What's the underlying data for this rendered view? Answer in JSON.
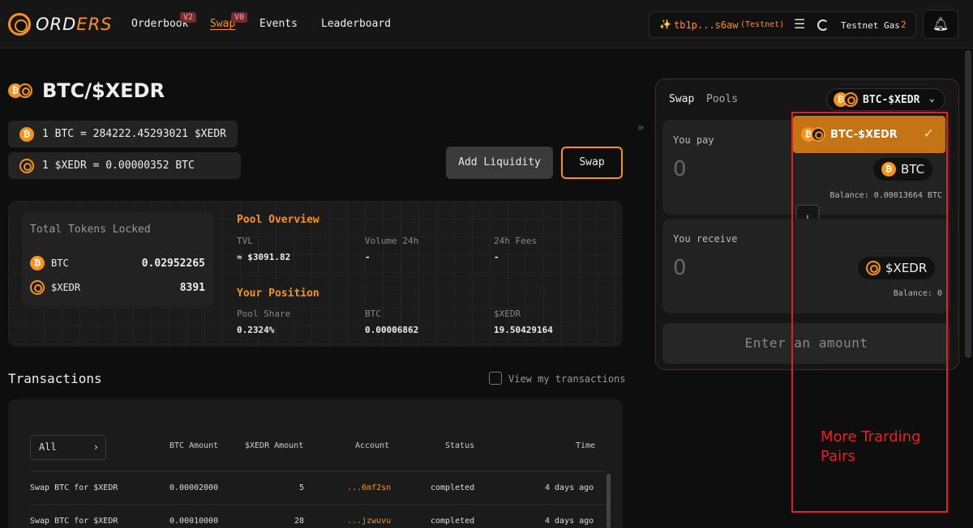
{
  "nav": {
    "logo_prefix": "ORD",
    "logo_suffix": "ERS",
    "items": [
      {
        "label": "Orderbook",
        "badge": "V2"
      },
      {
        "label": "Swap",
        "badge": "V0"
      },
      {
        "label": "Events"
      },
      {
        "label": "Leaderboard"
      }
    ],
    "wallet_address": "tb1p...s6aw",
    "wallet_network": "(Testnet)",
    "gas_label": "Testnet Gas",
    "gas_count": "2",
    "wallet_icon": "✨"
  },
  "pair": {
    "title": "BTC/$XEDR",
    "rate_btc": "1 BTC = 284222.45293021 $XEDR",
    "rate_xedr": "1 $XEDR = 0.00000352 BTC"
  },
  "actions": {
    "add_liquidity": "Add Liquidity",
    "swap": "Swap"
  },
  "pool": {
    "tvl_title": "Total Tokens Locked",
    "tokens": [
      {
        "name": "BTC",
        "value": "0.02952265"
      },
      {
        "name": "$XEDR",
        "value": "8391"
      }
    ],
    "overview_title": "Pool Overview",
    "overview": [
      {
        "label": "TVL",
        "value": "≈ $3091.82"
      },
      {
        "label": "Volume 24h",
        "value": "-"
      },
      {
        "label": "24h Fees",
        "value": "-"
      }
    ],
    "position_title": "Your Position",
    "position": [
      {
        "label": "Pool Share",
        "value": "0.2324%"
      },
      {
        "label": "BTC",
        "value": "0.00006862"
      },
      {
        "label": "$XEDR",
        "value": "19.50429164"
      }
    ]
  },
  "transactions": {
    "title": "Transactions",
    "view_mine": "View my transactions",
    "filter": "All",
    "columns": [
      "BTC Amount",
      "$XEDR Amount",
      "Account",
      "Status",
      "Time"
    ],
    "rows": [
      {
        "type": "Swap BTC for $XEDR",
        "btc": "0.00002000",
        "xedr": "5",
        "account": "...6mf2sn",
        "status": "completed",
        "time": "4 days ago"
      },
      {
        "type": "Swap BTC for $XEDR",
        "btc": "0.00010000",
        "xedr": "28",
        "account": "...jzwuvu",
        "status": "completed",
        "time": "4 days ago"
      }
    ]
  },
  "swap_card": {
    "tabs": [
      "Swap",
      "Pools"
    ],
    "selected_pair": "BTC-$XEDR",
    "you_pay": "You pay",
    "pay_amount": "0",
    "pay_token": "BTC",
    "pay_balance": "Balance: 0.00013664 BTC",
    "you_receive": "You receive",
    "receive_amount": "0",
    "receive_token": "$XEDR",
    "receive_balance": "Balance: 0",
    "cta": "Enter an amount"
  },
  "dropdown": {
    "option": "BTC-$XEDR"
  },
  "annotation": {
    "text": "More Trarding Pairs",
    "color": "#e8201d"
  },
  "colors": {
    "accent": "#f7931a",
    "background": "#0e0e0e"
  }
}
